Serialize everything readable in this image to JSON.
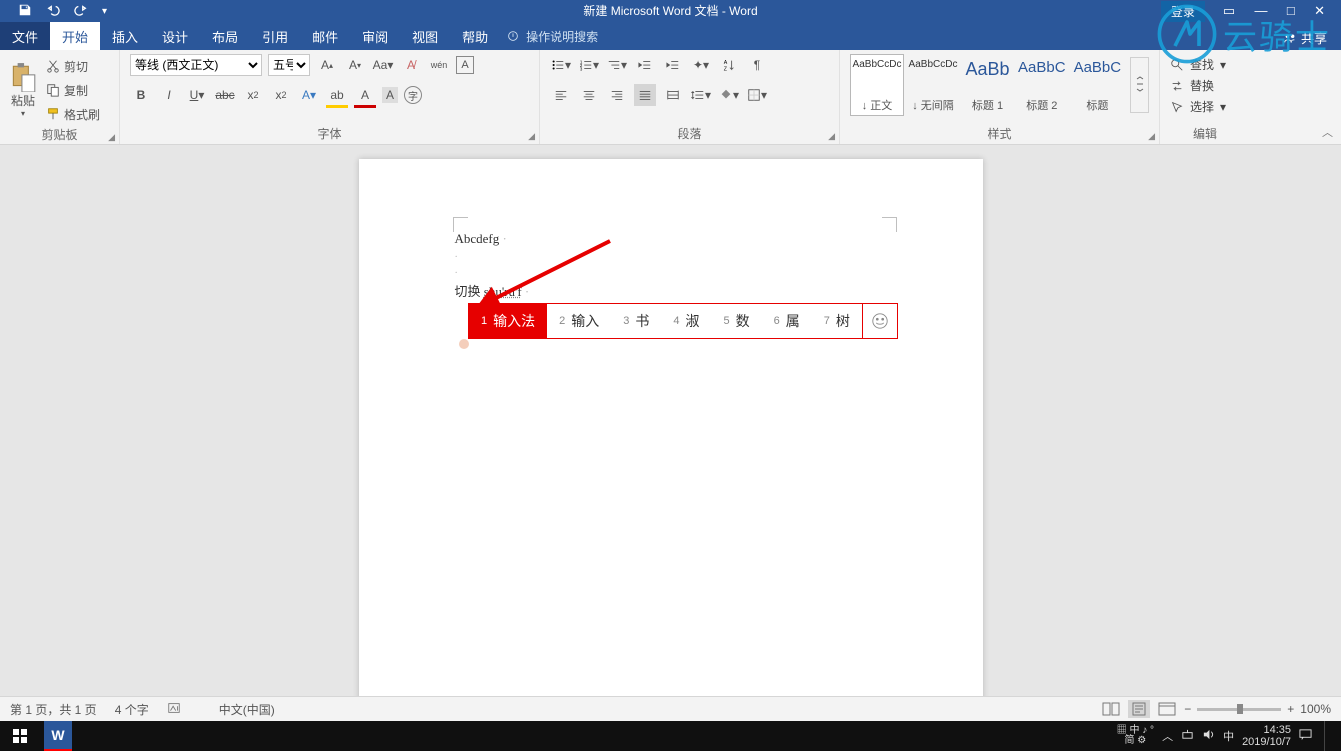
{
  "title": "新建 Microsoft Word 文档  -  Word",
  "login": "登录",
  "share": "共享",
  "tabs": {
    "file": "文件",
    "home": "开始",
    "insert": "插入",
    "design": "设计",
    "layout": "布局",
    "references": "引用",
    "mailings": "邮件",
    "review": "审阅",
    "view": "视图",
    "help": "帮助",
    "tellme": "操作说明搜索"
  },
  "ribbon": {
    "clipboard": {
      "paste": "粘贴",
      "cut": "剪切",
      "copy": "复制",
      "painter": "格式刷",
      "label": "剪贴板"
    },
    "font": {
      "font_name": "等线 (西文正文)",
      "font_size": "五号",
      "label": "字体"
    },
    "paragraph": {
      "label": "段落"
    },
    "styles": {
      "items": [
        {
          "preview": "AaBbCcDc",
          "name": "↓ 正文"
        },
        {
          "preview": "AaBbCcDc",
          "name": "↓ 无间隔"
        },
        {
          "preview": "AaBb",
          "name": "标题 1"
        },
        {
          "preview": "AaBbC",
          "name": "标题 2"
        },
        {
          "preview": "AaBbC",
          "name": "标题"
        }
      ],
      "label": "样式"
    },
    "editing": {
      "find": "查找",
      "replace": "替换",
      "select": "选择",
      "label": "编辑"
    }
  },
  "doc": {
    "line1": "Abcdefg",
    "line2_pre": "切换 ",
    "line2_pinyin": "shu'ru'f"
  },
  "ime": {
    "candidates": [
      {
        "n": "1",
        "t": "输入法"
      },
      {
        "n": "2",
        "t": "输入"
      },
      {
        "n": "3",
        "t": "书"
      },
      {
        "n": "4",
        "t": "淑"
      },
      {
        "n": "5",
        "t": "数"
      },
      {
        "n": "6",
        "t": "属"
      },
      {
        "n": "7",
        "t": "树"
      }
    ]
  },
  "status": {
    "page": "第 1 页，共 1 页",
    "words": "4 个字",
    "lang": "中文(中国)",
    "zoom": "100%"
  },
  "watermark": "云骑士",
  "tray": {
    "ime1": "中",
    "ime2": "简",
    "ime_lang": "中",
    "time": "14:35",
    "date": "2019/10/7"
  }
}
